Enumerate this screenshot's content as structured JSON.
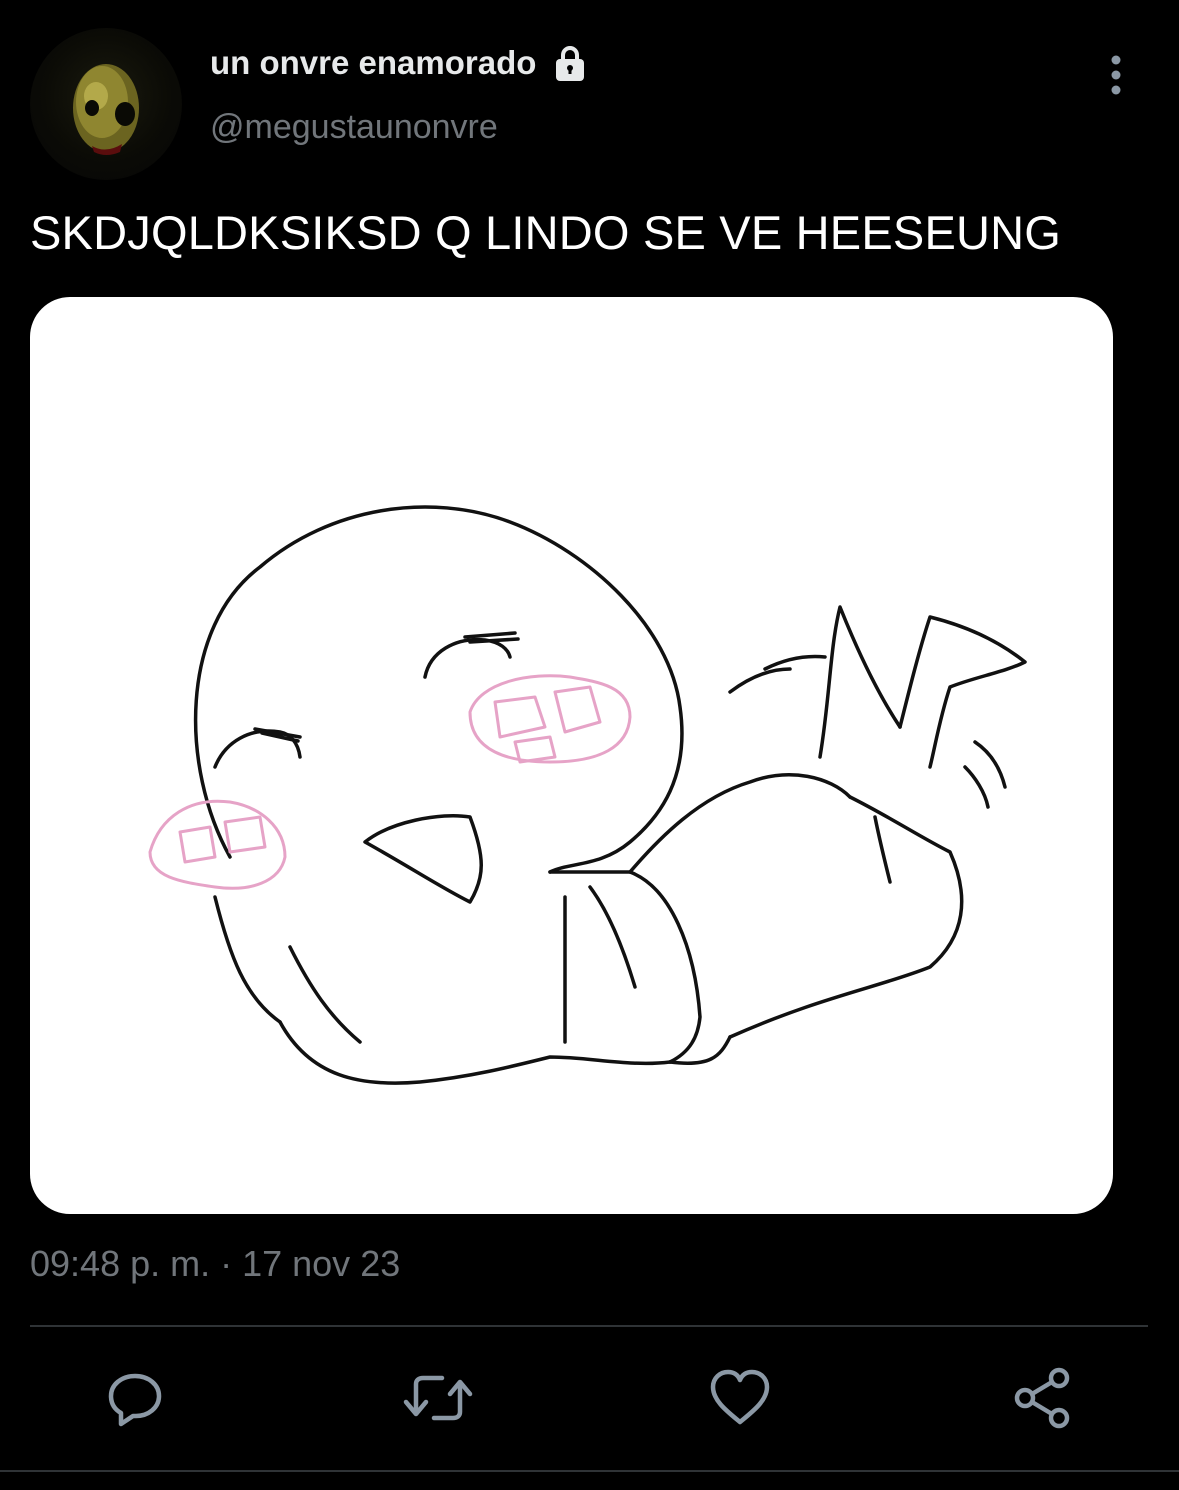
{
  "author": {
    "display_name": "un onvre enamorado",
    "handle": "@megustaunonvre",
    "avatar_icon": "avatar-icon",
    "protected_icon": "lock-icon"
  },
  "tweet": {
    "text": "SKDJQLDKSIKSD Q LINDO SE VE HEESEUNG",
    "timestamp": "09:48 p. m. · 17 nov 23"
  },
  "media": {
    "icon": "doodle-image"
  },
  "actions": [
    {
      "name": "reply",
      "icon": "reply-icon"
    },
    {
      "name": "retweet",
      "icon": "retweet-icon"
    },
    {
      "name": "like",
      "icon": "heart-icon"
    },
    {
      "name": "share",
      "icon": "share-icon"
    }
  ],
  "colors": {
    "background": "#000000",
    "primary_text": "#e7e9ea",
    "secondary_text": "#71767b",
    "divider": "#2f3336",
    "icon": "#8b98a5",
    "blush": "#e6a3c7"
  }
}
